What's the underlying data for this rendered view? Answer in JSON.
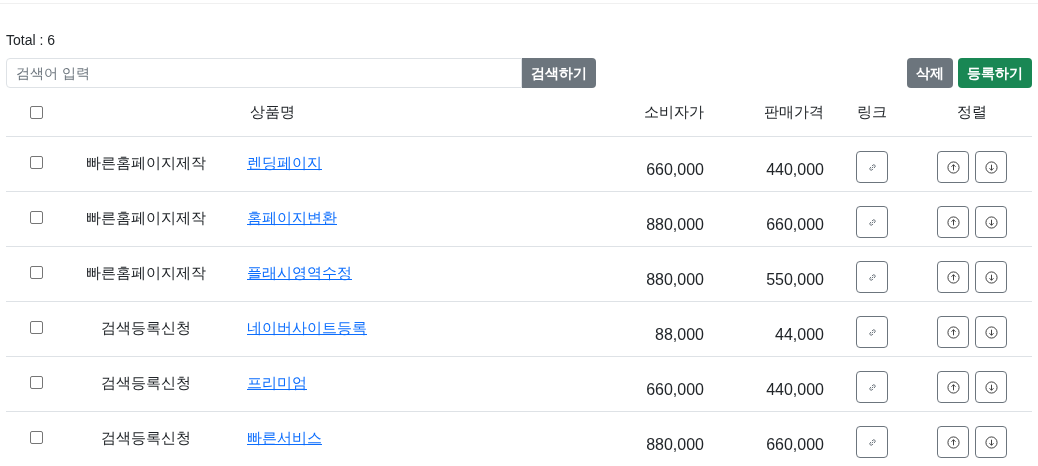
{
  "total": "Total : 6",
  "search": {
    "placeholder": "검색어 입력",
    "button": "검색하기"
  },
  "actions": [
    {
      "label": "삭제",
      "kind": "secondary"
    },
    {
      "label": "등록하기",
      "kind": "primary"
    }
  ],
  "table": {
    "columns": [
      "상품명",
      "소비자가",
      "판매가격",
      "링크",
      "정렬"
    ],
    "header_checked": false,
    "rows": [
      {
        "checked": false,
        "category": "빠른홈페이지제작",
        "name": "렌딩페이지",
        "consumer_price": "660,000",
        "sale_price": "440,000"
      },
      {
        "checked": false,
        "category": "빠른홈페이지제작",
        "name": "홈페이지변환",
        "consumer_price": "880,000",
        "sale_price": "660,000"
      },
      {
        "checked": false,
        "category": "빠른홈페이지제작",
        "name": "플래시영역수정",
        "consumer_price": "880,000",
        "sale_price": "550,000"
      },
      {
        "checked": false,
        "category": "검색등록신청",
        "name": "네이버사이트등록",
        "consumer_price": "88,000",
        "sale_price": "44,000"
      },
      {
        "checked": false,
        "category": "검색등록신청",
        "name": "프리미엄",
        "consumer_price": "660,000",
        "sale_price": "440,000"
      },
      {
        "checked": false,
        "category": "검색등록신청",
        "name": "빠른서비스",
        "consumer_price": "880,000",
        "sale_price": "660,000"
      }
    ]
  }
}
